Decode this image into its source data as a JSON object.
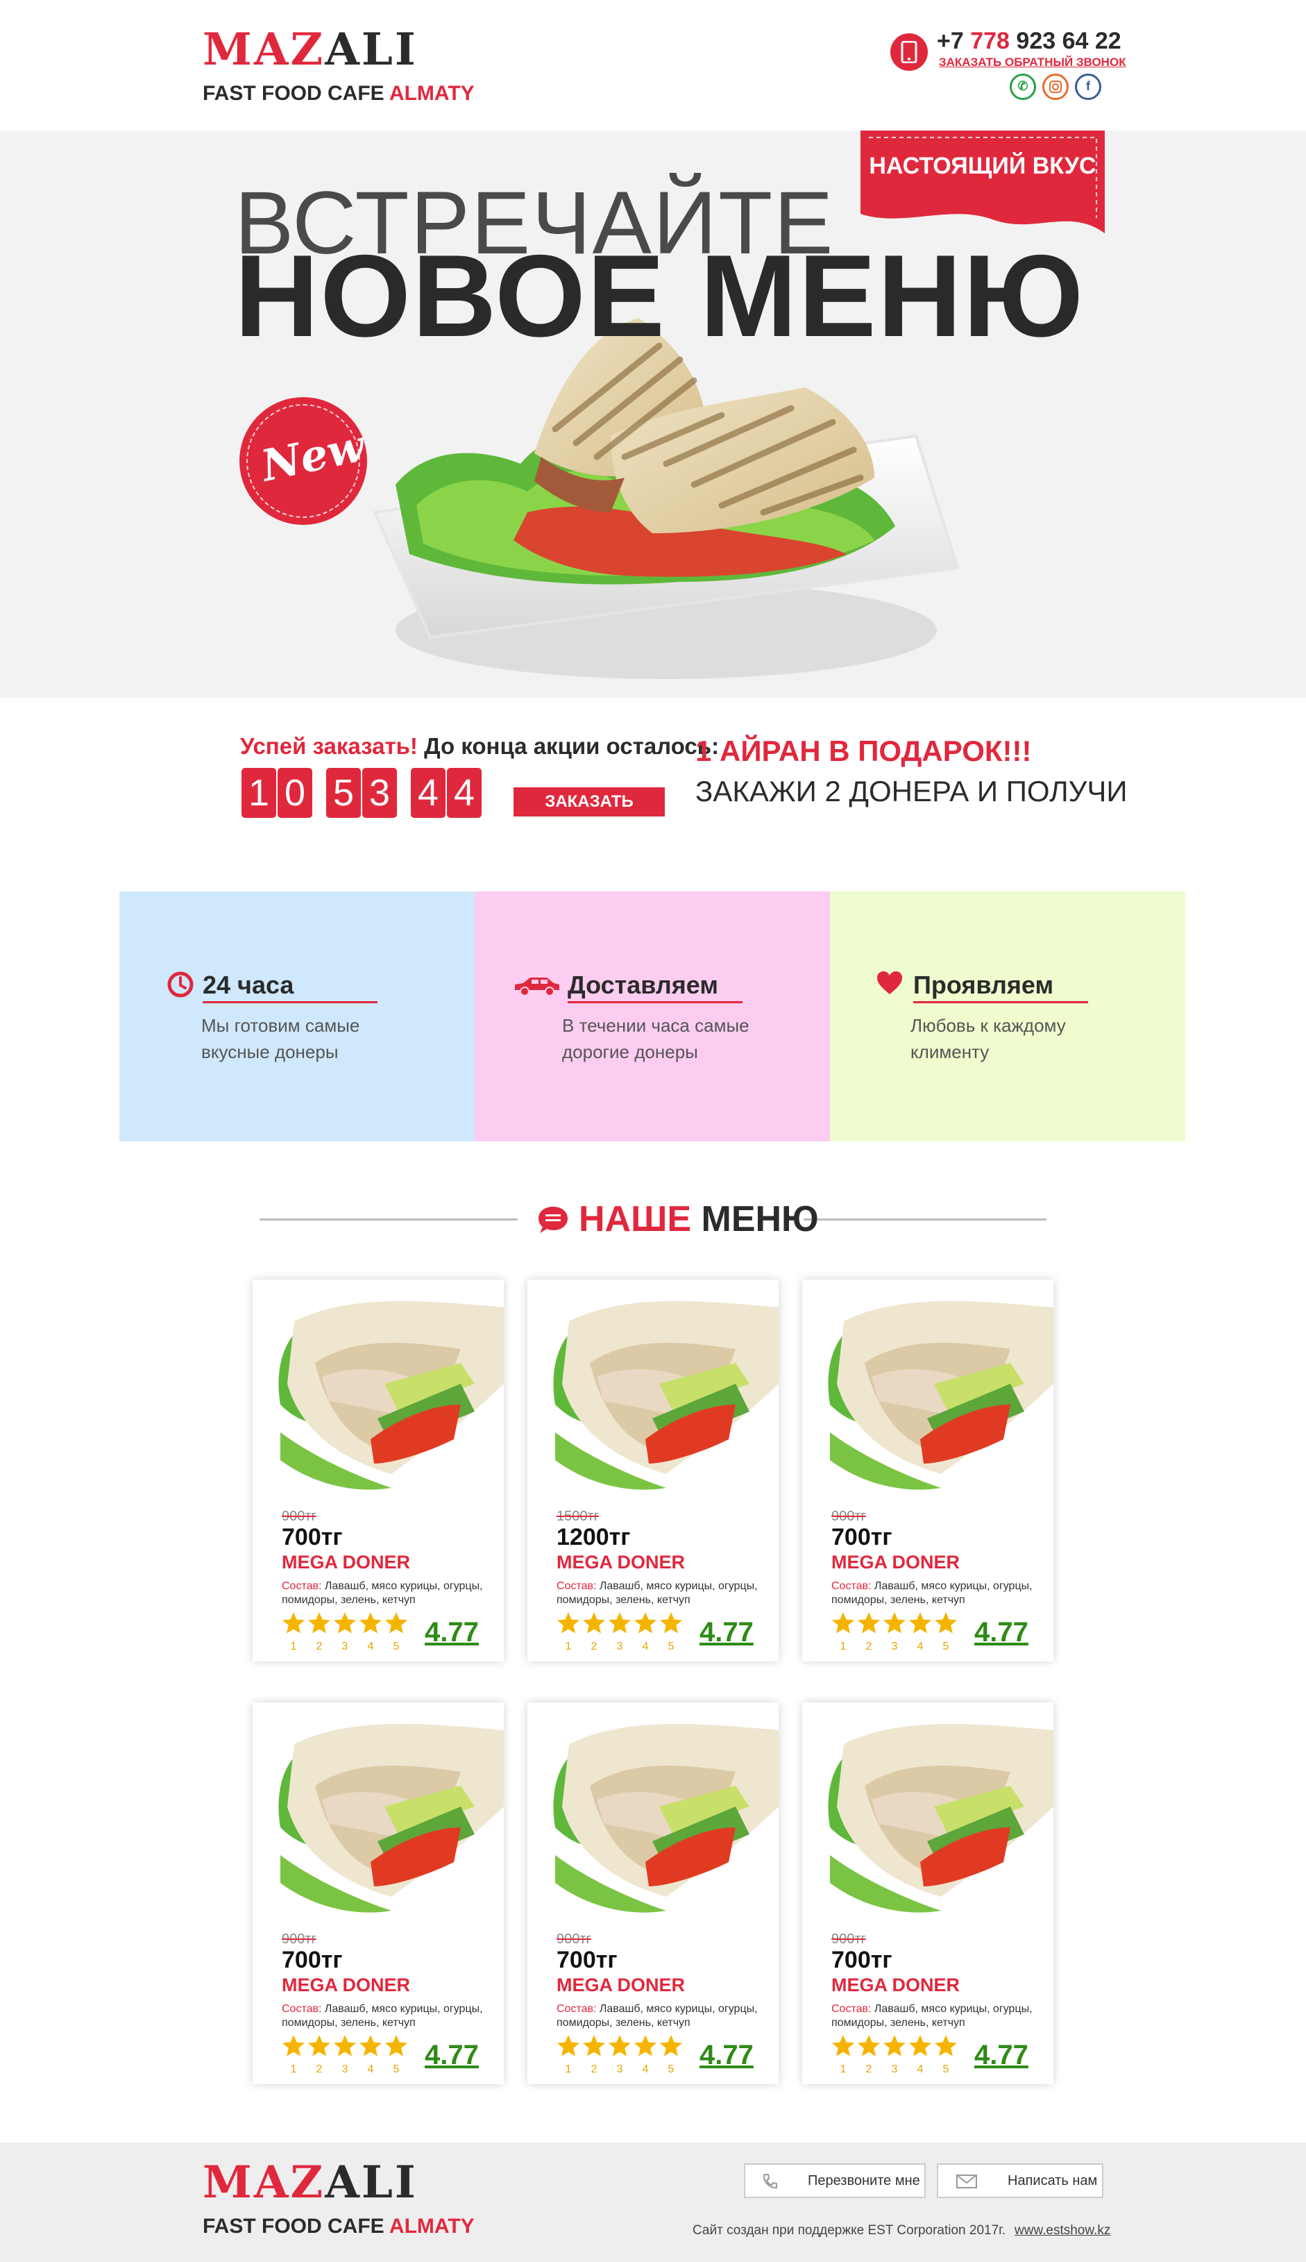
{
  "brand": {
    "logo_red": "MAZ",
    "logo_dark": "ALI",
    "sub_dark": "FAST FOOD CAFE",
    "sub_red": "ALMATY"
  },
  "contact": {
    "phone_prefix": "+7",
    "phone_code": "778",
    "phone_rest": "923 64 22",
    "callback": "ЗАКАЗАТЬ ОБРАТНЫЙ ЗВОНОК"
  },
  "social": [
    {
      "icon": "whatsapp-icon",
      "color": "#25a244"
    },
    {
      "icon": "instagram-icon",
      "color": "#e96a2a"
    },
    {
      "icon": "facebook-icon",
      "color": "#3b5998"
    }
  ],
  "hero": {
    "line1": "ВСТРЕЧАЙТЕ",
    "line2": "НОВОЕ МЕНЮ",
    "flag": "НАСТОЯЩИЙ ВКУС",
    "badge": "New"
  },
  "promo": {
    "hurry": "Успей заказать!",
    "until": "До конца акции осталось:",
    "digits": [
      "1",
      "0",
      "5",
      "3",
      "4",
      "4"
    ],
    "order_button": "ЗАКАЗАТЬ",
    "gift_title": "1 АЙРАН В ПОДАРОК!!!",
    "gift_sub": "ЗАКАЖИ 2 ДОНЕРА И ПОЛУЧИ"
  },
  "features": [
    {
      "title": "24 часа",
      "desc": "Мы готовим самые вкусные донеры",
      "icon": "clock-icon",
      "bg": "#cfe8fc"
    },
    {
      "title": "Доставляем",
      "desc": "В течении часа самые дорогие донеры",
      "icon": "car-icon",
      "bg": "#fccdf1"
    },
    {
      "title": "Проявляем",
      "desc": "Любовь к каждому клименту",
      "icon": "heart-icon",
      "bg": "#effccd"
    }
  ],
  "menu": {
    "title_red": "НАШЕ",
    "title_dark": "МЕНЮ"
  },
  "products": [
    {
      "old_price": "900тг",
      "price": "700тг",
      "name": "MEGA DONER",
      "comp_label": "Состав:",
      "comp": "Лавашб, мясо курицы, огурцы, помидоры, зелень, кетчуп",
      "rating": "4.77",
      "stars": 5
    },
    {
      "old_price": "1500тг",
      "price": "1200тг",
      "name": "MEGA DONER",
      "comp_label": "Состав:",
      "comp": "Лавашб, мясо курицы, огурцы, помидоры, зелень, кетчуп",
      "rating": "4.77",
      "stars": 5
    },
    {
      "old_price": "900тг",
      "price": "700тг",
      "name": "MEGA DONER",
      "comp_label": "Состав:",
      "comp": "Лавашб, мясо курицы, огурцы, помидоры, зелень, кетчуп",
      "rating": "4.77",
      "stars": 5
    },
    {
      "old_price": "900тг",
      "price": "700тг",
      "name": "MEGA DONER",
      "comp_label": "Состав:",
      "comp": "Лавашб, мясо курицы, огурцы, помидоры, зелень, кетчуп",
      "rating": "4.77",
      "stars": 5
    },
    {
      "old_price": "900тг",
      "price": "700тг",
      "name": "MEGA DONER",
      "comp_label": "Состав:",
      "comp": "Лавашб, мясо курицы, огурцы, помидоры, зелень, кетчуп",
      "rating": "4.77",
      "stars": 5
    },
    {
      "old_price": "900тг",
      "price": "700тг",
      "name": "MEGA DONER",
      "comp_label": "Состав:",
      "comp": "Лавашб, мясо курицы, огурцы, помидоры, зелень, кетчуп",
      "rating": "4.77",
      "stars": 5
    }
  ],
  "star_labels": [
    "1",
    "2",
    "3",
    "4",
    "5"
  ],
  "footer": {
    "callback_button": "Перезвоните мне",
    "write_button": "Написать нам",
    "copyright": "Сайт создан при поддержке EST Corporation 2017г.",
    "site_link": "www.estshow.kz"
  },
  "colors": {
    "accent": "#e0283d",
    "rating": "#2e8b16",
    "star": "#f5b400"
  }
}
